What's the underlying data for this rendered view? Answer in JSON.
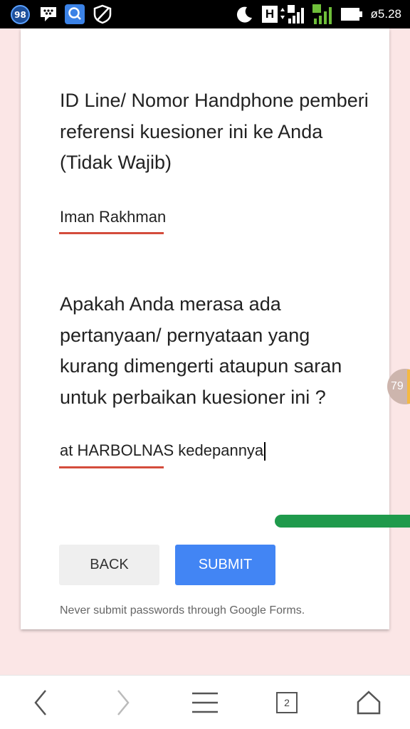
{
  "status_bar": {
    "notification_count": "98",
    "network_type": "H",
    "time": "ø5.28",
    "icons": [
      "notification-badge-icon",
      "bbm-icon",
      "search-app-icon",
      "shield-icon",
      "moon-icon",
      "network-h-icon",
      "signal-sim1-icon",
      "signal-sim2-icon",
      "battery-icon"
    ]
  },
  "form": {
    "question_1": "ID Line/ Nomor Handphone pemberi referensi kuesioner ini ke Anda (Tidak Wajib)",
    "answer_1": "Iman Rakhman",
    "question_2": "Apakah Anda merasa ada pertanyaan/ pernyataan yang kurang dimengerti ataupun saran untuk perbaikan kuesioner ini ?",
    "answer_2": "at HARBOLNAS kedepannya",
    "back_label": "BACK",
    "submit_label": "SUBMIT",
    "notice": "Never submit passwords through Google Forms."
  },
  "overlay": {
    "floating_count": "79"
  },
  "bottom_nav": {
    "tab_count": "2",
    "icons": [
      "back-arrow-icon",
      "forward-arrow-icon",
      "menu-icon",
      "tabs-icon",
      "home-icon"
    ]
  },
  "colors": {
    "accent_underline": "#d44c3c",
    "submit_blue": "#4285f4",
    "page_background": "#fbe6e6"
  }
}
